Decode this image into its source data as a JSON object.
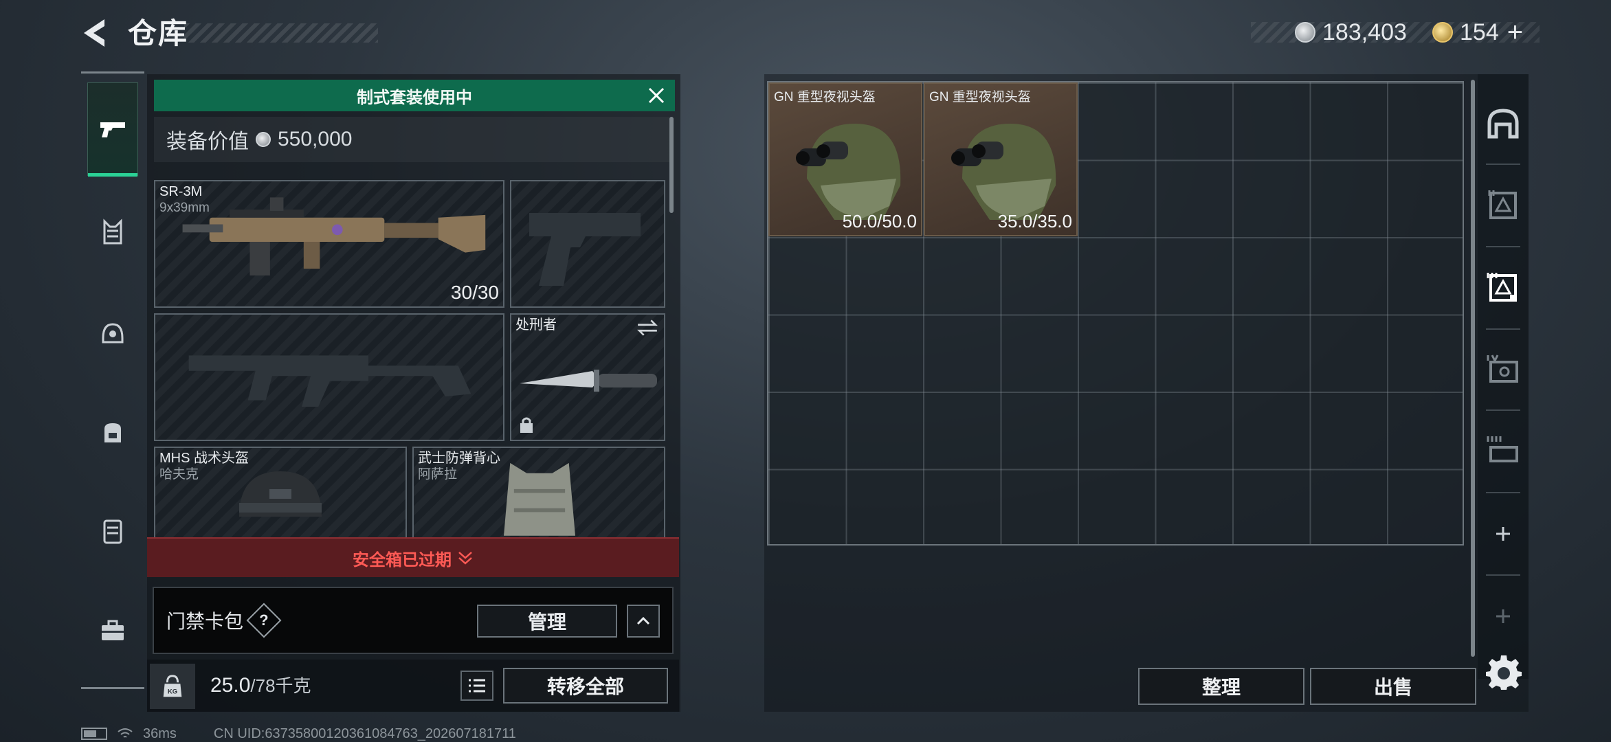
{
  "header": {
    "title": "仓库",
    "silver_amount": "183,403",
    "gold_amount": "154",
    "plus_label": "+"
  },
  "rail": {
    "items": [
      {
        "name": "pistol",
        "active": true
      },
      {
        "name": "vest"
      },
      {
        "name": "helmet"
      },
      {
        "name": "backpack"
      },
      {
        "name": "armor"
      },
      {
        "name": "case"
      }
    ]
  },
  "loadout": {
    "banner": "制式套装使用中",
    "value_label": "装备价值",
    "value_amount": "550,000",
    "primary": {
      "name": "SR-3M",
      "caliber": "9x39mm",
      "ammo": "30/30"
    },
    "melee": {
      "name": "处刑者"
    },
    "helmet": {
      "name": "MHS 战术头盔",
      "sub": "哈夫克"
    },
    "vest": {
      "name": "武士防弹背心",
      "sub": "阿萨拉"
    },
    "safebox": "安全箱已过期",
    "keycard_label": "门禁卡包",
    "help_label": "?",
    "manage_label": "管理",
    "weight_value": "25.0",
    "weight_max": "/78千克",
    "kg_label": "KG",
    "transfer_label": "转移全部"
  },
  "stash": {
    "items": [
      {
        "name": "GN 重型夜视头盔",
        "durability": "50.0/50.0"
      },
      {
        "name": "GN 重型夜视头盔",
        "durability": "35.0/35.0"
      }
    ],
    "sort_label": "整理",
    "sell_label": "出售"
  },
  "status": {
    "ping": "36ms",
    "uid": "CN UID:6373580012036108476​3_202607181711"
  },
  "colors": {
    "accent_green": "#0e6b4d",
    "active_underline": "#2bd296",
    "alert_red": "#ff5a55"
  }
}
